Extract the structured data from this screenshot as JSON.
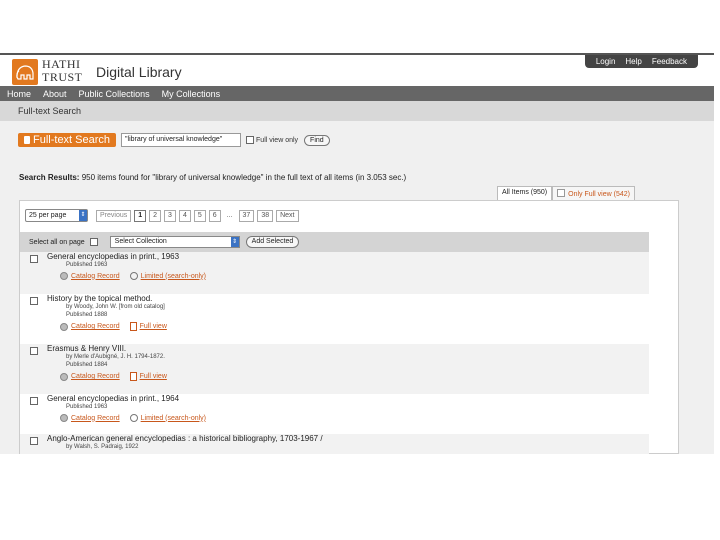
{
  "header": {
    "logo_line1": "HATHI",
    "logo_line2": "TRUST",
    "site_name": "Digital Library",
    "top_links": [
      "Login",
      "Help",
      "Feedback"
    ]
  },
  "nav": [
    "Home",
    "About",
    "Public Collections",
    "My Collections"
  ],
  "breadcrumb": "Full-text Search",
  "search": {
    "badge": "Full-text Search",
    "query": "\"library of universal knowledge\"",
    "full_view_only_label": "Full view only",
    "find_label": "Find"
  },
  "results": {
    "label": "Search Results:",
    "summary": "950 items found for \"library of universal knowledge\" in the full text of all items (in 3.053 sec.)"
  },
  "tabs": {
    "all": "All Items (950)",
    "full": "Only Full view (542)"
  },
  "pager": {
    "per_page": "25 per page",
    "previous": "Previous",
    "pages": [
      "1",
      "2",
      "3",
      "4",
      "5",
      "6",
      "...",
      "37",
      "38"
    ],
    "current": "1",
    "next": "Next"
  },
  "select_bar": {
    "select_all_label": "Select all on page",
    "collection_select": "Select Collection",
    "add_selected": "Add Selected"
  },
  "items": [
    {
      "title": "General encyclopedias in print., 1963",
      "meta": [
        "Published 1963"
      ],
      "links": [
        {
          "label": "Catalog Record",
          "icon": "catalog-icon",
          "style": "link"
        },
        {
          "label": "Limited (search-only)",
          "icon": "magnifier-icon",
          "style": "link"
        }
      ]
    },
    {
      "title": "History by the topical method.",
      "meta": [
        "by Woody, John W. [from old catalog]",
        "Published 1888"
      ],
      "links": [
        {
          "label": "Catalog Record",
          "icon": "catalog-icon",
          "style": "link"
        },
        {
          "label": "Full view",
          "icon": "document-icon",
          "style": "link"
        }
      ]
    },
    {
      "title": "Erasmus & Henry VIII.",
      "meta": [
        "by Merle d'Aubigné, J. H. 1794-1872.",
        "Published 1884"
      ],
      "links": [
        {
          "label": "Catalog Record",
          "icon": "catalog-icon",
          "style": "link"
        },
        {
          "label": "Full view",
          "icon": "document-icon",
          "style": "link"
        }
      ]
    },
    {
      "title": "General encyclopedias in print., 1964",
      "meta": [
        "Published 1963"
      ],
      "links": [
        {
          "label": "Catalog Record",
          "icon": "catalog-icon",
          "style": "link"
        },
        {
          "label": "Limited (search-only)",
          "icon": "magnifier-icon",
          "style": "link"
        }
      ]
    },
    {
      "title": "Anglo-American general encyclopedias : a historical bibliography, 1703-1967 /",
      "meta": [
        "by Walsh, S. Padraig, 1922"
      ],
      "links": []
    }
  ]
}
